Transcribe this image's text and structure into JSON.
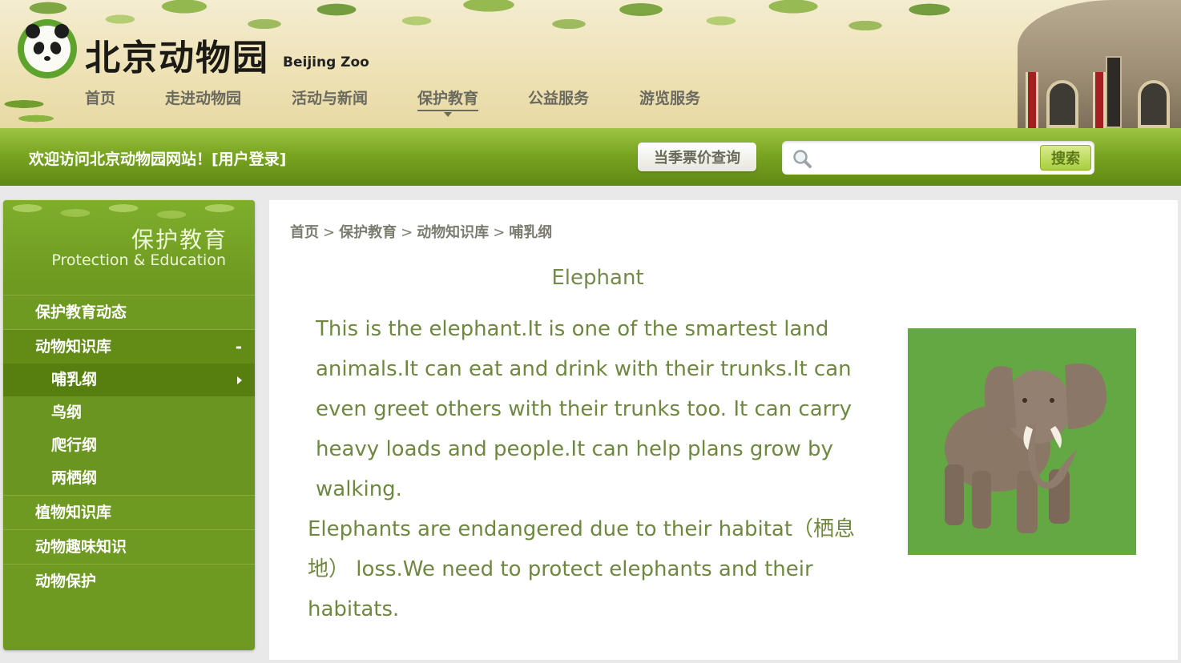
{
  "site": {
    "logo_cn": "北京动物园",
    "logo_en": "Beijing Zoo"
  },
  "nav": {
    "items": [
      "首页",
      "走进动物园",
      "活动与新闻",
      "保护教育",
      "公益服务",
      "游览服务"
    ],
    "active": "保护教育"
  },
  "bar": {
    "welcome": "欢迎访问北京动物园网站！[用户登录]",
    "ticket_button": "当季票价查询",
    "search_placeholder": "",
    "search_button": "搜索"
  },
  "sidebar": {
    "title_cn": "保护教育",
    "title_en": "Protection & Education",
    "items": [
      {
        "label": "保护教育动态"
      },
      {
        "label": "动物知识库",
        "toggle": "-"
      },
      {
        "label": "哺乳纲"
      },
      {
        "label": "鸟纲"
      },
      {
        "label": "爬行纲"
      },
      {
        "label": "两栖纲"
      },
      {
        "label": "植物知识库"
      },
      {
        "label": "动物趣味知识"
      },
      {
        "label": "动物保护"
      }
    ]
  },
  "breadcrumb": [
    "首页",
    "保护教育",
    "动物知识库",
    "哺乳纲"
  ],
  "article": {
    "title": "Elephant",
    "paragraph1": "This is the elephant.It is one of the smartest land animals.It can eat and drink with their trunks.It can even greet others with their trunks too. It can carry heavy loads and people.It can help plans grow by walking.",
    "paragraph2": "Elephants are endangered due to their habitat（栖息地） loss.We need to protect elephants and their habitats."
  },
  "colors": {
    "green_bar": "#7aa521",
    "sidebar": "#6f9a22",
    "body_text": "#6f8840",
    "photo_bg": "#64a843"
  }
}
